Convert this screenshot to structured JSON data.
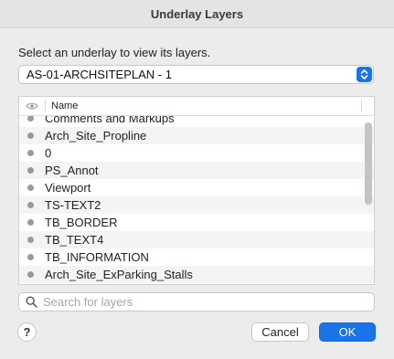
{
  "window": {
    "title": "Underlay Layers"
  },
  "instruction": "Select an underlay to view its layers.",
  "underlay_select": {
    "selected": "AS-01-ARCHSITEPLAN - 1"
  },
  "layers_table": {
    "header": {
      "name_column": "Name"
    },
    "rows": [
      "Comments and Markups",
      "Arch_Site_Propline",
      "0",
      "PS_Annot",
      "Viewport",
      "TS-TEXT2",
      "TB_BORDER",
      "TB_TEXT4",
      "TB_INFORMATION",
      "Arch_Site_ExParking_Stalls"
    ]
  },
  "search": {
    "placeholder": "Search for layers",
    "value": ""
  },
  "buttons": {
    "help": "?",
    "cancel": "Cancel",
    "ok": "OK"
  },
  "colors": {
    "accent": "#1a73e8",
    "visibility_dot": "#9a9a9a"
  }
}
